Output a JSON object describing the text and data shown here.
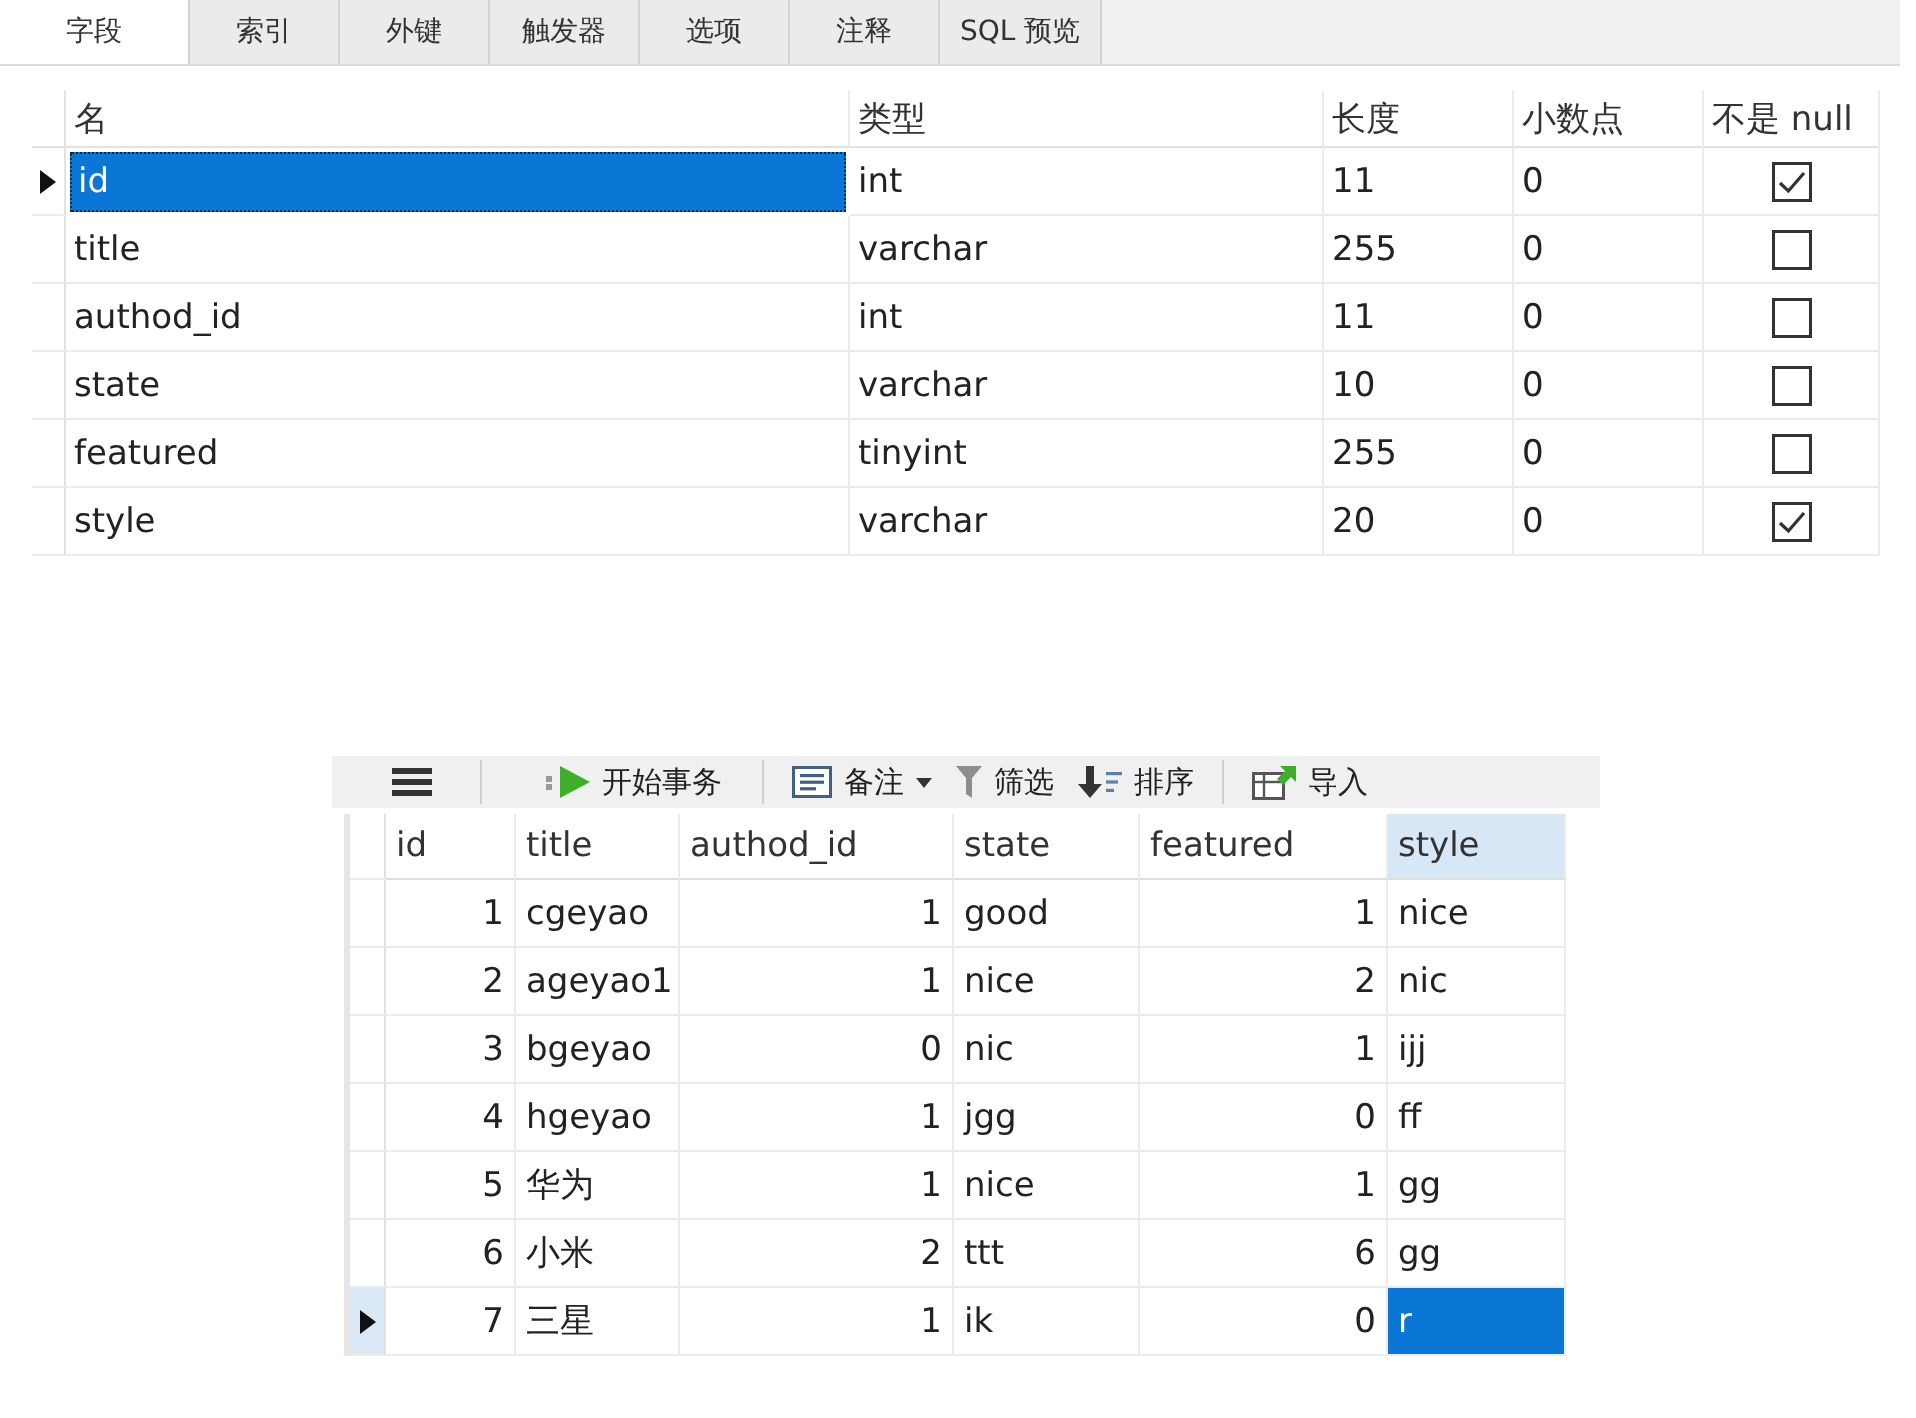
{
  "tabs": [
    {
      "label": "字段",
      "selected": true
    },
    {
      "label": "索引",
      "selected": false
    },
    {
      "label": "外键",
      "selected": false
    },
    {
      "label": "触发器",
      "selected": false
    },
    {
      "label": "选项",
      "selected": false
    },
    {
      "label": "注释",
      "selected": false
    },
    {
      "label": "SQL 预览",
      "selected": false
    }
  ],
  "fields": {
    "columns": [
      "名",
      "类型",
      "长度",
      "小数点",
      "不是 null"
    ],
    "rows": [
      {
        "current": true,
        "selected": true,
        "name": "id",
        "type": "int",
        "length": "11",
        "decimals": "0",
        "not_null": true
      },
      {
        "current": false,
        "selected": false,
        "name": "title",
        "type": "varchar",
        "length": "255",
        "decimals": "0",
        "not_null": false
      },
      {
        "current": false,
        "selected": false,
        "name": "authod_id",
        "type": "int",
        "length": "11",
        "decimals": "0",
        "not_null": false
      },
      {
        "current": false,
        "selected": false,
        "name": "state",
        "type": "varchar",
        "length": "10",
        "decimals": "0",
        "not_null": false
      },
      {
        "current": false,
        "selected": false,
        "name": "featured",
        "type": "tinyint",
        "length": "255",
        "decimals": "0",
        "not_null": false
      },
      {
        "current": false,
        "selected": false,
        "name": "style",
        "type": "varchar",
        "length": "20",
        "decimals": "0",
        "not_null": true
      }
    ]
  },
  "toolbar": {
    "groups": [
      {
        "items": [
          {
            "kind": "menu"
          }
        ]
      },
      {
        "items": [
          {
            "kind": "transaction",
            "label": "开始事务"
          }
        ]
      },
      {
        "items": [
          {
            "kind": "note",
            "label": "备注",
            "dropdown": true
          },
          {
            "kind": "filter",
            "label": "筛选",
            "dropdown": false
          },
          {
            "kind": "sort",
            "label": "排序",
            "dropdown": false
          }
        ]
      },
      {
        "items": [
          {
            "kind": "import",
            "label": "导入"
          }
        ]
      }
    ]
  },
  "records": {
    "columns": [
      {
        "label": "id",
        "kind": "number",
        "selected": false
      },
      {
        "label": "title",
        "kind": "text",
        "selected": false
      },
      {
        "label": "authod_id",
        "kind": "number",
        "selected": false
      },
      {
        "label": "state",
        "kind": "text",
        "selected": false
      },
      {
        "label": "featured",
        "kind": "number",
        "selected": false
      },
      {
        "label": "style",
        "kind": "text",
        "selected": true
      }
    ],
    "rows": [
      {
        "current": false,
        "cells": [
          {
            "text": "1",
            "selected": false
          },
          {
            "text": "cgeyao",
            "selected": false
          },
          {
            "text": "1",
            "selected": false
          },
          {
            "text": "good",
            "selected": false
          },
          {
            "text": "1",
            "selected": false
          },
          {
            "text": "nice",
            "selected": false
          }
        ]
      },
      {
        "current": false,
        "cells": [
          {
            "text": "2",
            "selected": false
          },
          {
            "text": "ageyao1",
            "selected": false
          },
          {
            "text": "1",
            "selected": false
          },
          {
            "text": "nice",
            "selected": false
          },
          {
            "text": "2",
            "selected": false
          },
          {
            "text": "nic",
            "selected": false
          }
        ]
      },
      {
        "current": false,
        "cells": [
          {
            "text": "3",
            "selected": false
          },
          {
            "text": "bgeyao",
            "selected": false
          },
          {
            "text": "0",
            "selected": false
          },
          {
            "text": "nic",
            "selected": false
          },
          {
            "text": "1",
            "selected": false
          },
          {
            "text": "ijj",
            "selected": false
          }
        ]
      },
      {
        "current": false,
        "cells": [
          {
            "text": "4",
            "selected": false
          },
          {
            "text": "hgeyao",
            "selected": false
          },
          {
            "text": "1",
            "selected": false
          },
          {
            "text": "jgg",
            "selected": false
          },
          {
            "text": "0",
            "selected": false
          },
          {
            "text": "ff",
            "selected": false
          }
        ]
      },
      {
        "current": false,
        "cells": [
          {
            "text": "5",
            "selected": false
          },
          {
            "text": "华为",
            "selected": false
          },
          {
            "text": "1",
            "selected": false
          },
          {
            "text": "nice",
            "selected": false
          },
          {
            "text": "1",
            "selected": false
          },
          {
            "text": "gg",
            "selected": false
          }
        ]
      },
      {
        "current": false,
        "cells": [
          {
            "text": "6",
            "selected": false
          },
          {
            "text": "小米",
            "selected": false
          },
          {
            "text": "2",
            "selected": false
          },
          {
            "text": "ttt",
            "selected": false
          },
          {
            "text": "6",
            "selected": false
          },
          {
            "text": "gg",
            "selected": false
          }
        ]
      },
      {
        "current": true,
        "cells": [
          {
            "text": "7",
            "selected": false
          },
          {
            "text": "三星",
            "selected": false
          },
          {
            "text": "1",
            "selected": false
          },
          {
            "text": "ik",
            "selected": false
          },
          {
            "text": "0",
            "selected": false
          },
          {
            "text": "r",
            "selected": true
          }
        ]
      }
    ]
  }
}
